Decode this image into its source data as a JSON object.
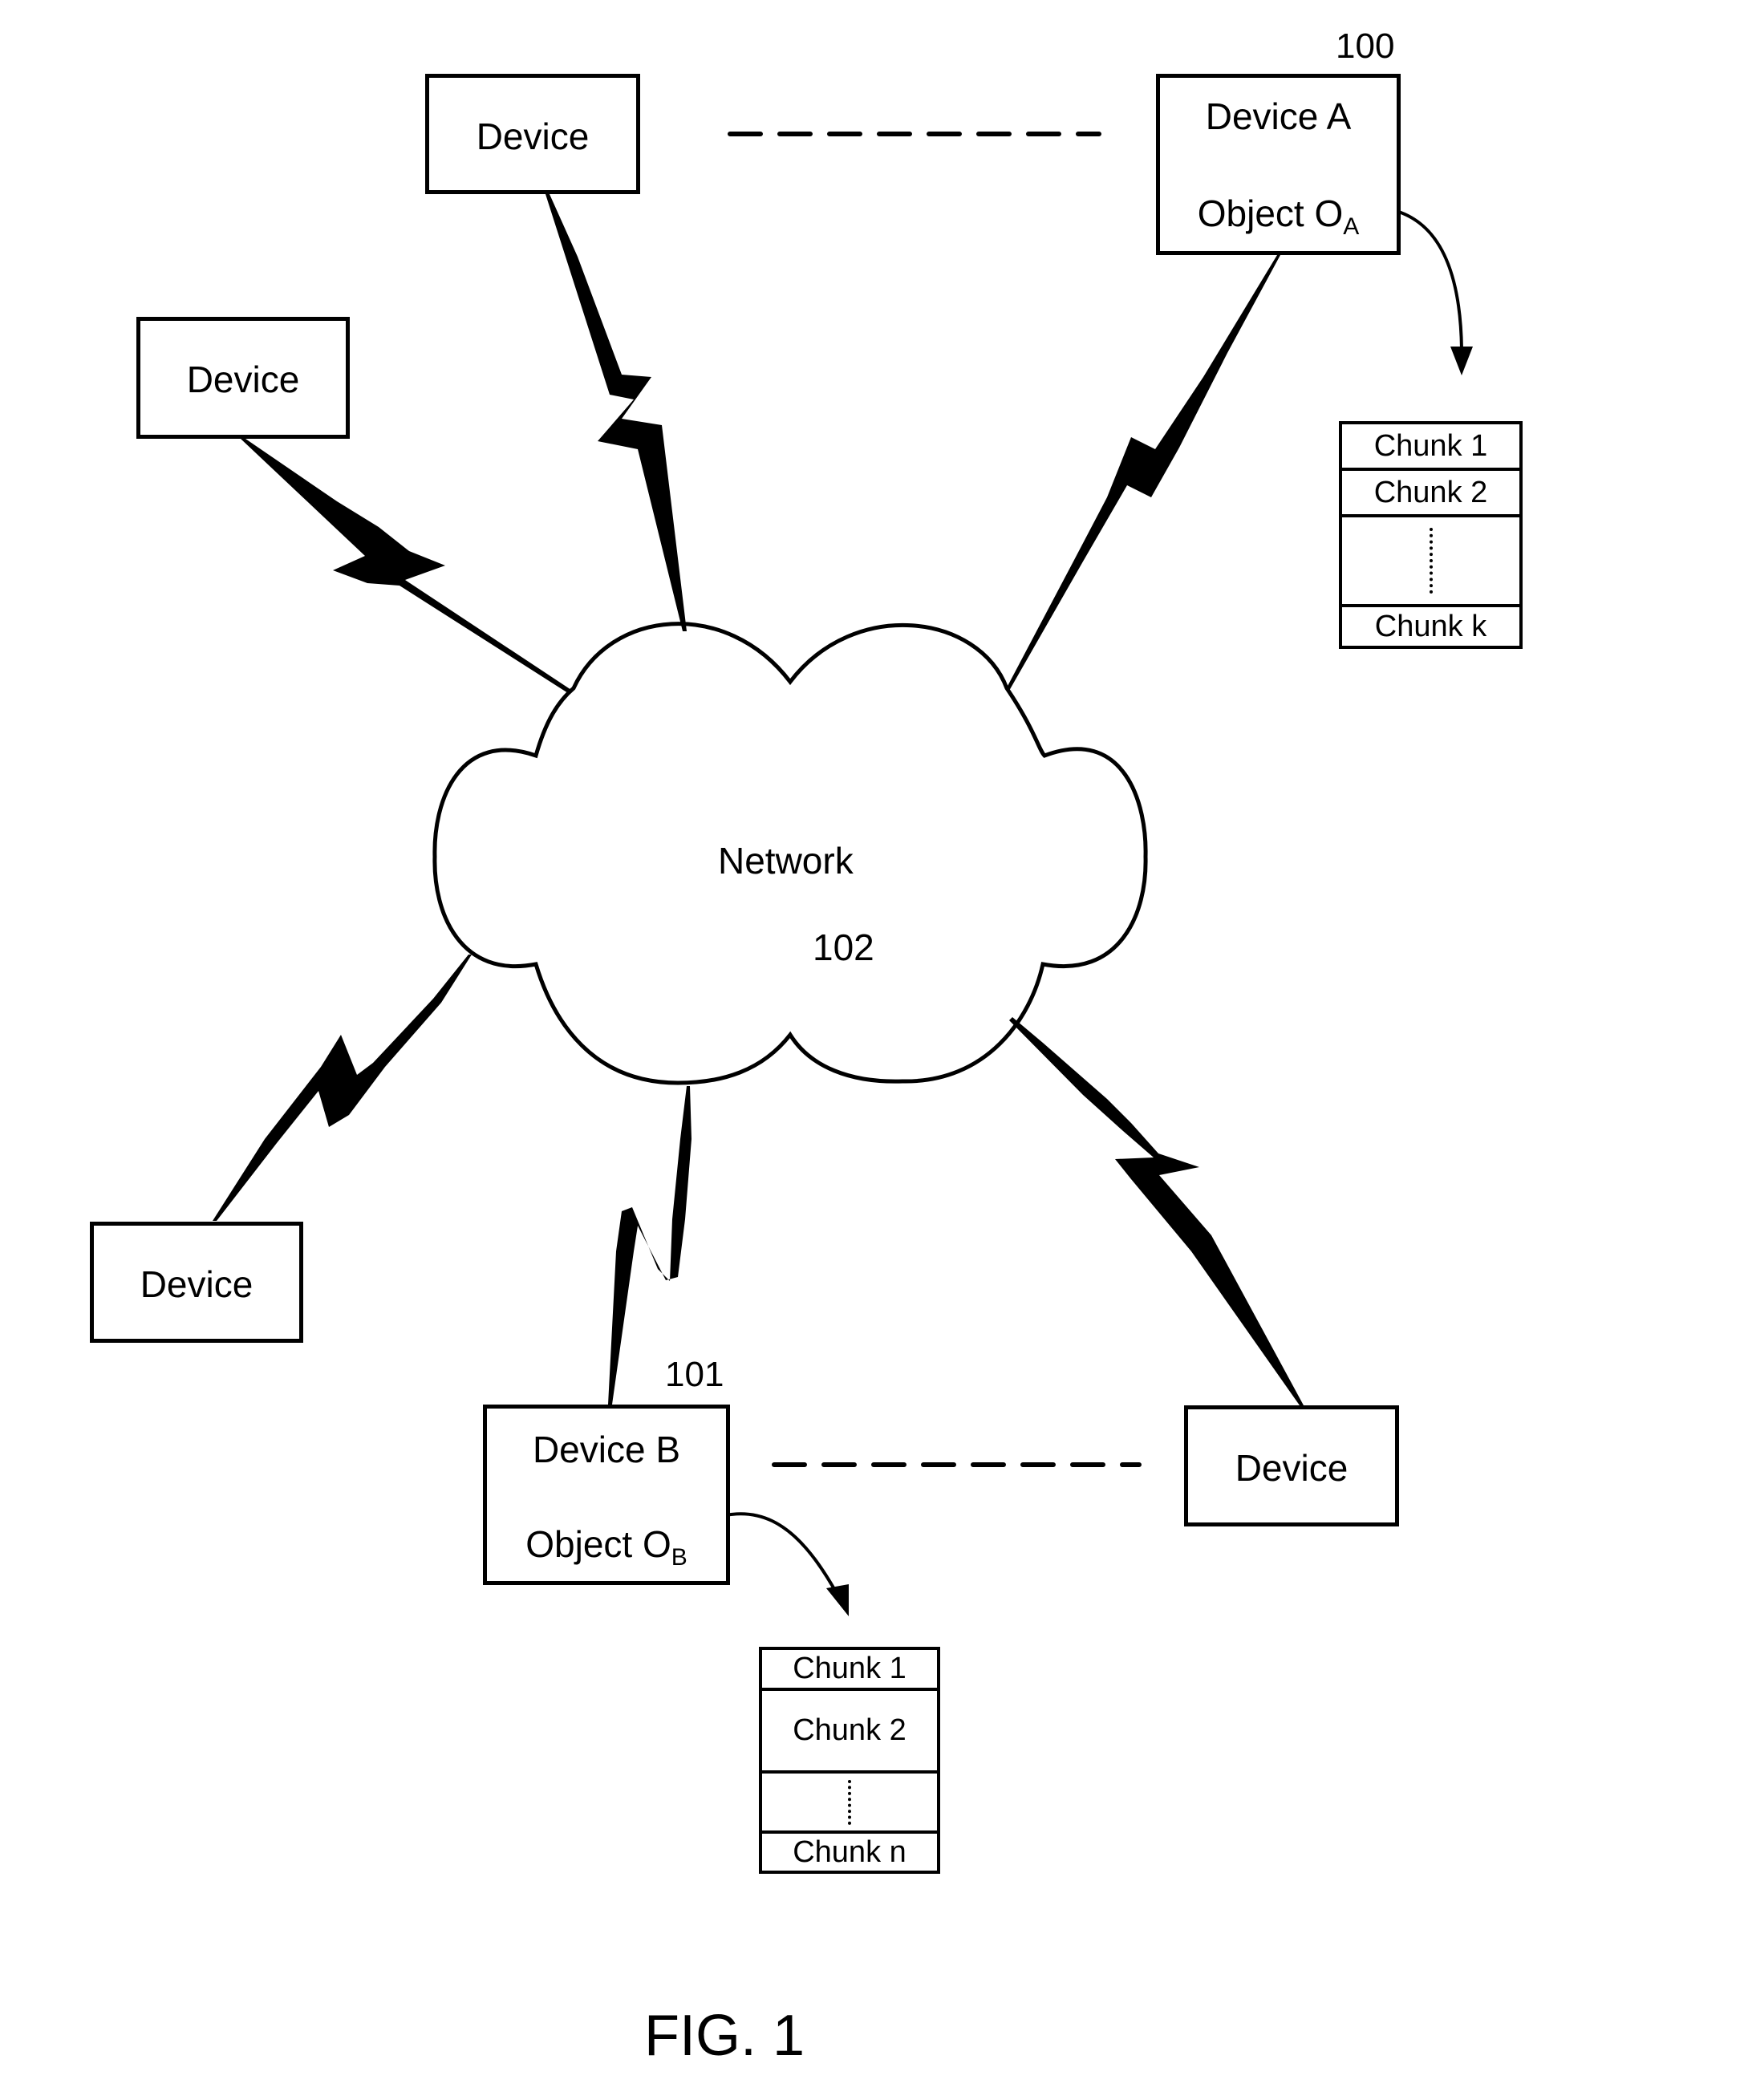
{
  "figure": {
    "caption": "FIG. 1"
  },
  "network": {
    "label": "Network",
    "ref": "102"
  },
  "devices": {
    "top": {
      "label": "Device"
    },
    "left": {
      "label": "Device"
    },
    "bottom_left": {
      "label": "Device"
    },
    "bottom_right": {
      "label": "Device"
    },
    "device_a": {
      "label": "Device A",
      "ref": "100",
      "object_label": "Object O",
      "object_sub": "A"
    },
    "device_b": {
      "label": "Device B",
      "ref": "101",
      "object_label": "Object O",
      "object_sub": "B"
    }
  },
  "chunks_a": {
    "rows": [
      "Chunk 1",
      "Chunk 2",
      "",
      "Chunk k"
    ]
  },
  "chunks_b": {
    "rows": [
      "Chunk 1",
      "Chunk 2",
      "",
      "Chunk n"
    ]
  },
  "connections": {
    "links": [
      {
        "from": "Device",
        "to": "Network",
        "type": "wireless"
      },
      {
        "from": "Device A",
        "to": "Network",
        "type": "wireless"
      },
      {
        "from": "Device",
        "to": "Network",
        "type": "wireless"
      },
      {
        "from": "Device",
        "to": "Network",
        "type": "wireless"
      },
      {
        "from": "Device B",
        "to": "Network",
        "type": "wireless"
      },
      {
        "from": "Device",
        "to": "Network",
        "type": "wireless"
      }
    ],
    "dashed": [
      {
        "from": "Device",
        "to": "Device A"
      },
      {
        "from": "Device B",
        "to": "Device"
      }
    ]
  }
}
